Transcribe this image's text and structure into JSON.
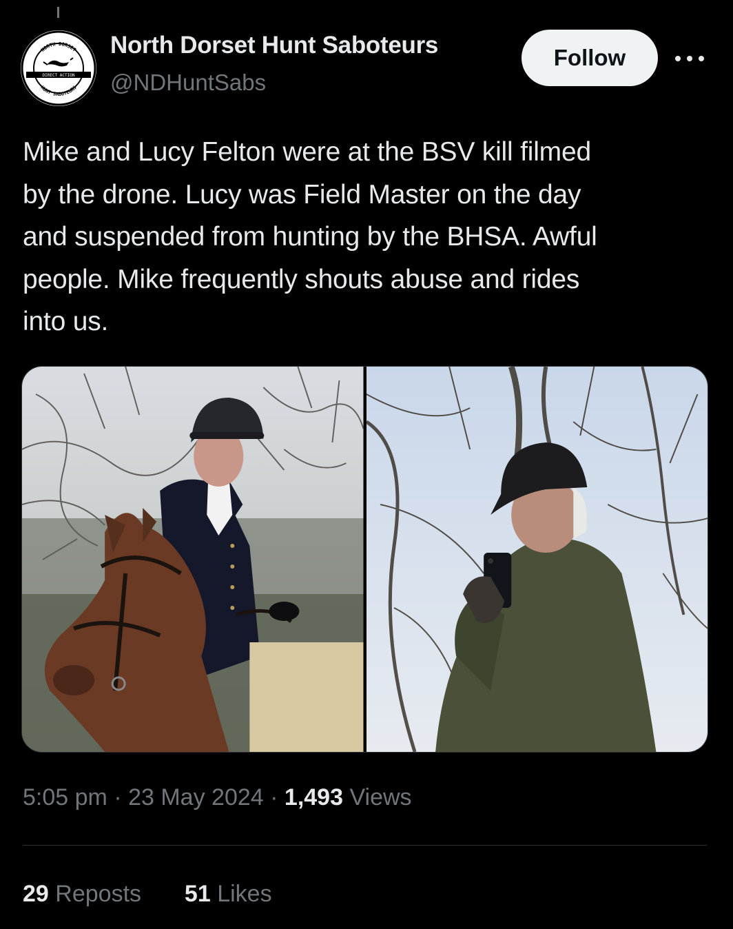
{
  "account": {
    "name": "North Dorset Hunt Saboteurs",
    "handle": "@NDHuntSabs",
    "avatar_logo_text": [
      "NORTH DORSET",
      "DIRECT ACTION",
      "HUNT SABOTEURS"
    ]
  },
  "actions": {
    "follow_label": "Follow",
    "more_icon": "more-horizontal-icon"
  },
  "tweet": {
    "text": "Mike and Lucy Felton were at the BSV kill filmed\nby the drone. Lucy was Field Master on the day\nand suspended from hunting by the BHSA. Awful\npeople. Mike frequently shouts abuse and rides\ninto us."
  },
  "media": {
    "photos": [
      "rider-on-horse-photo",
      "rider-with-phone-photo"
    ]
  },
  "meta": {
    "time": "5:05 pm",
    "separator": "·",
    "date": "23 May 2024",
    "views_count": "1,493",
    "views_label": "Views"
  },
  "stats": {
    "reposts_count": "29",
    "reposts_label": "Reposts",
    "likes_count": "51",
    "likes_label": "Likes"
  },
  "colors": {
    "background": "#000000",
    "primary_text": "#e7e9ea",
    "secondary_text": "#71767b",
    "follow_button_bg": "#eff3f4",
    "divider": "#2f3336"
  }
}
